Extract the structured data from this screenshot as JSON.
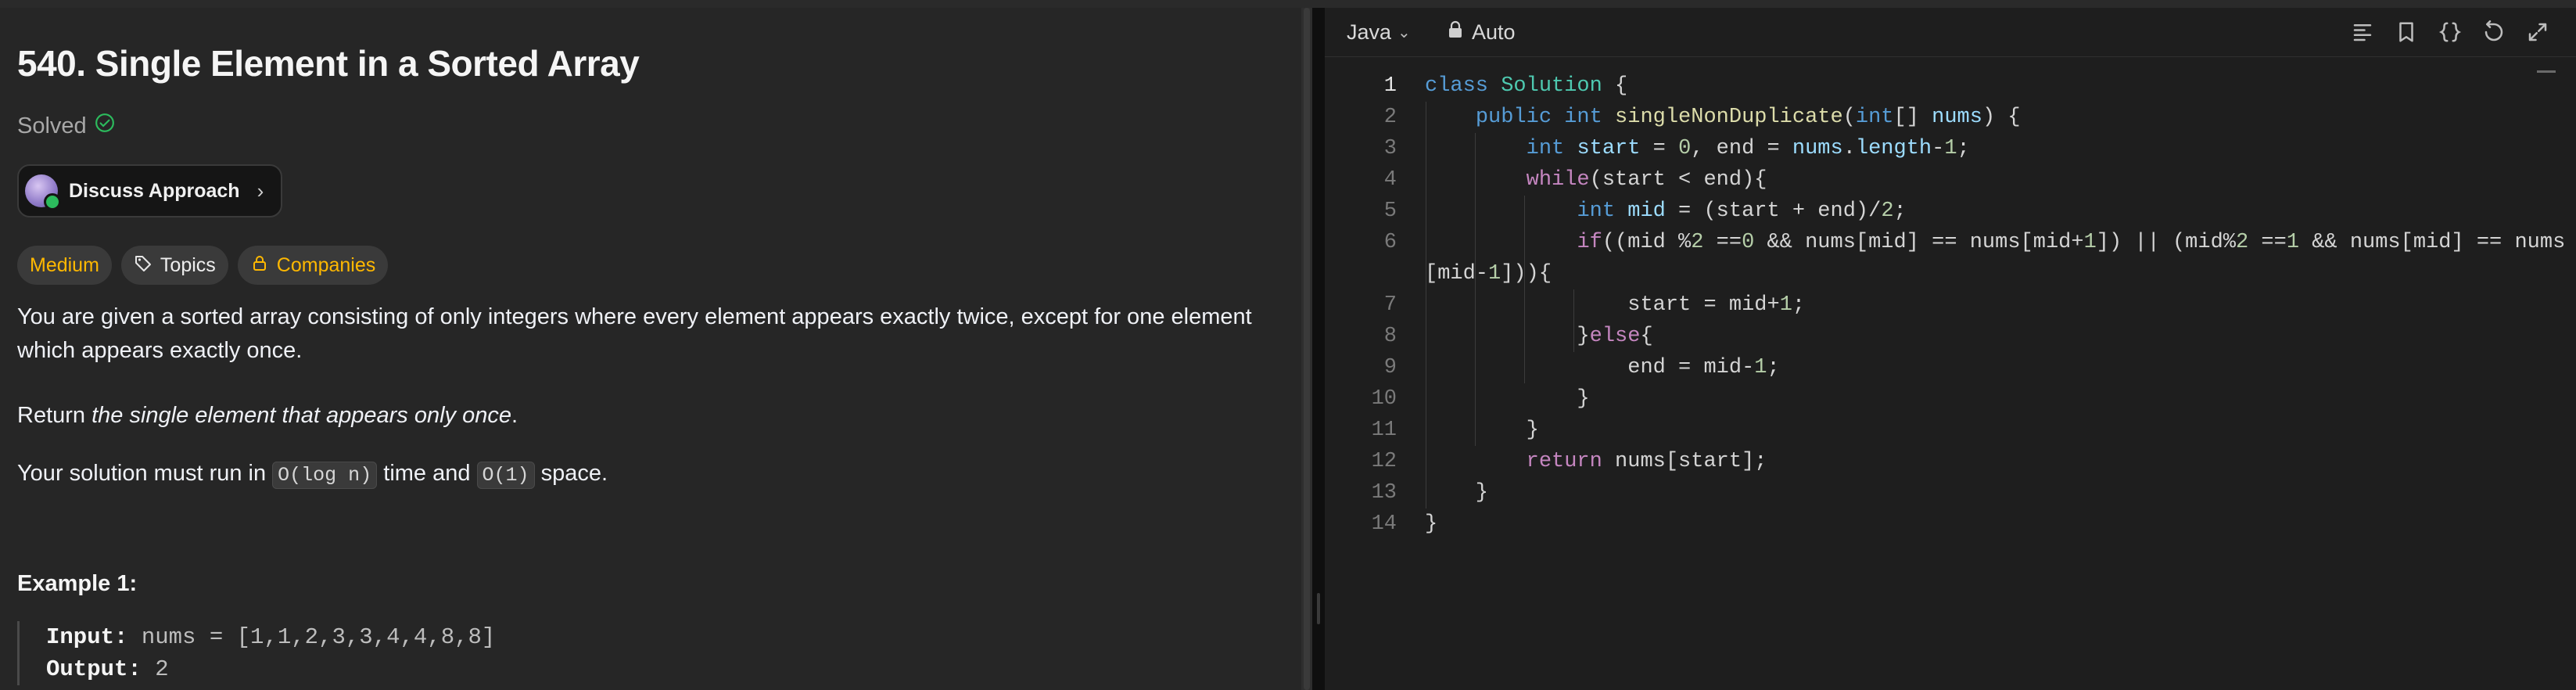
{
  "problem": {
    "title": "540. Single Element in a Sorted Array",
    "status": "Solved",
    "discuss_label": "Discuss Approach",
    "tags": {
      "difficulty": "Medium",
      "topics": "Topics",
      "companies": "Companies"
    },
    "para1": "You are given a sorted array consisting of only integers where every element appears exactly twice, except for one element which appears exactly once.",
    "para2_prefix": "Return ",
    "para2_italic": "the single element that appears only once",
    "para2_suffix": ".",
    "para3_a": "Your solution must run in ",
    "para3_code1": "O(log n)",
    "para3_b": " time and ",
    "para3_code2": "O(1)",
    "para3_c": " space.",
    "example_heading": "Example 1:",
    "example_input_label": "Input:",
    "example_input_value": "nums = [1,1,2,3,3,4,4,8,8]",
    "example_output_label": "Output:",
    "example_output_value": "2"
  },
  "editor": {
    "language": "Java",
    "mode": "Auto",
    "active_line": 1,
    "lines": [
      {
        "n": "1"
      },
      {
        "n": "2"
      },
      {
        "n": "3"
      },
      {
        "n": "4"
      },
      {
        "n": "5"
      },
      {
        "n": "6"
      },
      {
        "n": ""
      },
      {
        "n": "7"
      },
      {
        "n": "8"
      },
      {
        "n": "9"
      },
      {
        "n": "10"
      },
      {
        "n": "11"
      },
      {
        "n": "12"
      },
      {
        "n": "13"
      },
      {
        "n": "14"
      }
    ]
  },
  "icons": {
    "solved": "check-circle-icon",
    "discuss_chevron": "chevron-right-icon",
    "topics": "tag-icon",
    "companies": "lock-icon",
    "lang_chevron": "chevron-down-icon",
    "auto_lock": "lock-icon",
    "toolbar": [
      "format-icon",
      "bookmark-icon",
      "braces-icon",
      "reset-icon",
      "expand-icon"
    ]
  },
  "colors": {
    "solved_check": "#2cbb5d",
    "difficulty": "#ffb800",
    "keyword": "#569cd6",
    "control": "#c586c0",
    "class": "#4ec9b0"
  }
}
